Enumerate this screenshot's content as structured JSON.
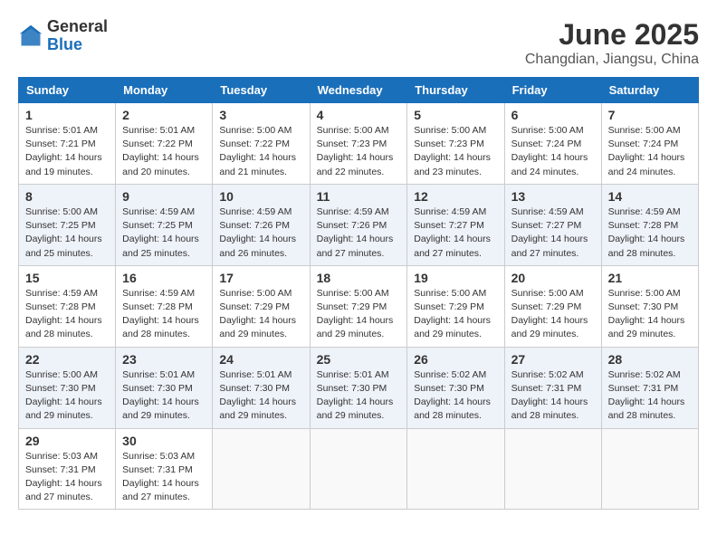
{
  "header": {
    "logo_general": "General",
    "logo_blue": "Blue",
    "month": "June 2025",
    "location": "Changdian, Jiangsu, China"
  },
  "weekdays": [
    "Sunday",
    "Monday",
    "Tuesday",
    "Wednesday",
    "Thursday",
    "Friday",
    "Saturday"
  ],
  "weeks": [
    [
      {
        "day": "1",
        "info": "Sunrise: 5:01 AM\nSunset: 7:21 PM\nDaylight: 14 hours\nand 19 minutes."
      },
      {
        "day": "2",
        "info": "Sunrise: 5:01 AM\nSunset: 7:22 PM\nDaylight: 14 hours\nand 20 minutes."
      },
      {
        "day": "3",
        "info": "Sunrise: 5:00 AM\nSunset: 7:22 PM\nDaylight: 14 hours\nand 21 minutes."
      },
      {
        "day": "4",
        "info": "Sunrise: 5:00 AM\nSunset: 7:23 PM\nDaylight: 14 hours\nand 22 minutes."
      },
      {
        "day": "5",
        "info": "Sunrise: 5:00 AM\nSunset: 7:23 PM\nDaylight: 14 hours\nand 23 minutes."
      },
      {
        "day": "6",
        "info": "Sunrise: 5:00 AM\nSunset: 7:24 PM\nDaylight: 14 hours\nand 24 minutes."
      },
      {
        "day": "7",
        "info": "Sunrise: 5:00 AM\nSunset: 7:24 PM\nDaylight: 14 hours\nand 24 minutes."
      }
    ],
    [
      {
        "day": "8",
        "info": "Sunrise: 5:00 AM\nSunset: 7:25 PM\nDaylight: 14 hours\nand 25 minutes."
      },
      {
        "day": "9",
        "info": "Sunrise: 4:59 AM\nSunset: 7:25 PM\nDaylight: 14 hours\nand 25 minutes."
      },
      {
        "day": "10",
        "info": "Sunrise: 4:59 AM\nSunset: 7:26 PM\nDaylight: 14 hours\nand 26 minutes."
      },
      {
        "day": "11",
        "info": "Sunrise: 4:59 AM\nSunset: 7:26 PM\nDaylight: 14 hours\nand 27 minutes."
      },
      {
        "day": "12",
        "info": "Sunrise: 4:59 AM\nSunset: 7:27 PM\nDaylight: 14 hours\nand 27 minutes."
      },
      {
        "day": "13",
        "info": "Sunrise: 4:59 AM\nSunset: 7:27 PM\nDaylight: 14 hours\nand 27 minutes."
      },
      {
        "day": "14",
        "info": "Sunrise: 4:59 AM\nSunset: 7:28 PM\nDaylight: 14 hours\nand 28 minutes."
      }
    ],
    [
      {
        "day": "15",
        "info": "Sunrise: 4:59 AM\nSunset: 7:28 PM\nDaylight: 14 hours\nand 28 minutes."
      },
      {
        "day": "16",
        "info": "Sunrise: 4:59 AM\nSunset: 7:28 PM\nDaylight: 14 hours\nand 28 minutes."
      },
      {
        "day": "17",
        "info": "Sunrise: 5:00 AM\nSunset: 7:29 PM\nDaylight: 14 hours\nand 29 minutes."
      },
      {
        "day": "18",
        "info": "Sunrise: 5:00 AM\nSunset: 7:29 PM\nDaylight: 14 hours\nand 29 minutes."
      },
      {
        "day": "19",
        "info": "Sunrise: 5:00 AM\nSunset: 7:29 PM\nDaylight: 14 hours\nand 29 minutes."
      },
      {
        "day": "20",
        "info": "Sunrise: 5:00 AM\nSunset: 7:29 PM\nDaylight: 14 hours\nand 29 minutes."
      },
      {
        "day": "21",
        "info": "Sunrise: 5:00 AM\nSunset: 7:30 PM\nDaylight: 14 hours\nand 29 minutes."
      }
    ],
    [
      {
        "day": "22",
        "info": "Sunrise: 5:00 AM\nSunset: 7:30 PM\nDaylight: 14 hours\nand 29 minutes."
      },
      {
        "day": "23",
        "info": "Sunrise: 5:01 AM\nSunset: 7:30 PM\nDaylight: 14 hours\nand 29 minutes."
      },
      {
        "day": "24",
        "info": "Sunrise: 5:01 AM\nSunset: 7:30 PM\nDaylight: 14 hours\nand 29 minutes."
      },
      {
        "day": "25",
        "info": "Sunrise: 5:01 AM\nSunset: 7:30 PM\nDaylight: 14 hours\nand 29 minutes."
      },
      {
        "day": "26",
        "info": "Sunrise: 5:02 AM\nSunset: 7:30 PM\nDaylight: 14 hours\nand 28 minutes."
      },
      {
        "day": "27",
        "info": "Sunrise: 5:02 AM\nSunset: 7:31 PM\nDaylight: 14 hours\nand 28 minutes."
      },
      {
        "day": "28",
        "info": "Sunrise: 5:02 AM\nSunset: 7:31 PM\nDaylight: 14 hours\nand 28 minutes."
      }
    ],
    [
      {
        "day": "29",
        "info": "Sunrise: 5:03 AM\nSunset: 7:31 PM\nDaylight: 14 hours\nand 27 minutes."
      },
      {
        "day": "30",
        "info": "Sunrise: 5:03 AM\nSunset: 7:31 PM\nDaylight: 14 hours\nand 27 minutes."
      },
      {
        "day": "",
        "info": ""
      },
      {
        "day": "",
        "info": ""
      },
      {
        "day": "",
        "info": ""
      },
      {
        "day": "",
        "info": ""
      },
      {
        "day": "",
        "info": ""
      }
    ]
  ]
}
